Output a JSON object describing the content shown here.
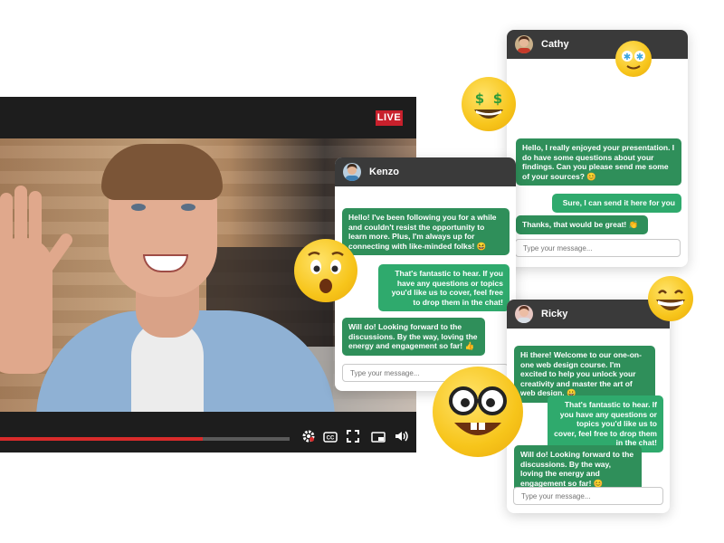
{
  "player": {
    "live_badge": "LIVE",
    "progress_percent": 70,
    "controls": [
      {
        "name": "settings-icon",
        "glyph": "⚙"
      },
      {
        "name": "captions-icon",
        "glyph": "CC"
      },
      {
        "name": "fullscreen-icon",
        "glyph": "⛶"
      },
      {
        "name": "miniplayer-icon",
        "glyph": "▭"
      },
      {
        "name": "volume-icon",
        "glyph": "🔊"
      }
    ]
  },
  "chats": {
    "kenzo": {
      "name": "Kenzo",
      "messages": [
        {
          "dir": "in",
          "text": "Hello! I've been following you for a while and couldn't resist the opportunity to learn more. Plus, I'm always up for connecting with like-minded folks! 😆"
        },
        {
          "dir": "out",
          "text": "That's fantastic to hear. If you have any questions or topics you'd like us to cover, feel free to drop them in the chat!"
        },
        {
          "dir": "in",
          "text": "Will do! Looking forward to the discussions. By the way, loving the energy and engagement so far! 👍"
        }
      ],
      "placeholder": "Type your message..."
    },
    "cathy": {
      "name": "Cathy",
      "messages": [
        {
          "dir": "in",
          "text": "Hello, I really enjoyed your presentation. I do have some questions about your findings. Can you please send me some of your sources? 😊"
        },
        {
          "dir": "out",
          "text": "Sure, I can send it here for you"
        },
        {
          "dir": "in",
          "text": "Thanks, that would be great! 👏"
        }
      ],
      "placeholder": "Type your message..."
    },
    "ricky": {
      "name": "Ricky",
      "messages": [
        {
          "dir": "in",
          "text": "Hi there! Welcome to our one-on-one web design course. I'm excited to help you unlock your creativity and master the art of web design. 😀"
        },
        {
          "dir": "out",
          "text": "That's fantastic to hear. If you have any questions or topics you'd like us to cover, feel free to drop them in the chat!"
        },
        {
          "dir": "in",
          "text": "Will do! Looking forward to the discussions. By the way, loving the energy and engagement so far! 😊"
        }
      ],
      "placeholder": "Type your message..."
    }
  },
  "emojis": [
    "money-eyes-emoji-icon",
    "star-eyes-emoji-icon",
    "surprised-emoji-icon",
    "grinning-emoji-icon",
    "nerd-emoji-icon"
  ],
  "colors": {
    "live_red": "#c8202c",
    "progress_red": "#d92b2b",
    "bubble_in": "#2f8f5a",
    "bubble_out": "#2faa6d",
    "chat_header": "#3a3a3a"
  }
}
